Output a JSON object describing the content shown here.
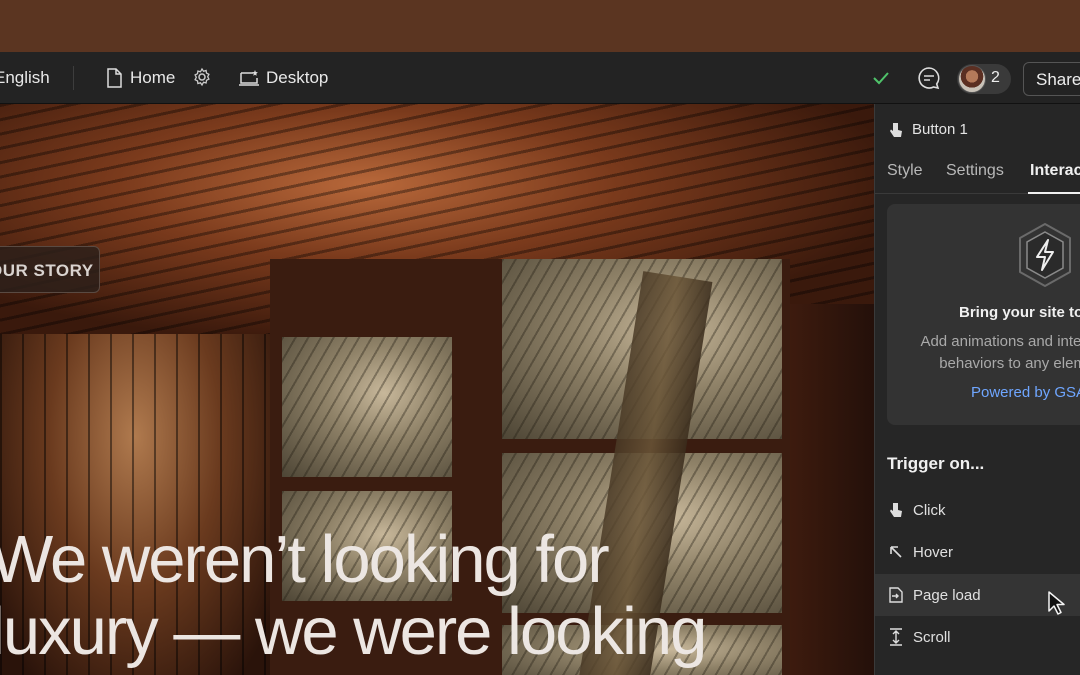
{
  "toolbar": {
    "language": "English",
    "page": "Home",
    "device": "Desktop",
    "collaborator_count": "2",
    "share_label": "Share"
  },
  "canvas": {
    "story_button": "OUR STORY",
    "headline_line1": "We weren’t looking for",
    "headline_line2": "luxury — we were looking"
  },
  "panel": {
    "element_name": "Button 1",
    "tabs": [
      "Style",
      "Settings",
      "Interactions"
    ],
    "promo": {
      "title": "Bring your site to life",
      "desc_line1": "Add animations and interactive",
      "desc_line2": "behaviors to any element",
      "link": "Powered by GSAP"
    },
    "trigger_heading": "Trigger on...",
    "triggers": [
      {
        "label": "Click",
        "icon": "hand-pointer-icon"
      },
      {
        "label": "Hover",
        "icon": "arrow-up-left-icon"
      },
      {
        "label": "Page load",
        "icon": "page-load-icon"
      },
      {
        "label": "Scroll",
        "icon": "scroll-icon"
      }
    ]
  },
  "colors": {
    "accent_link": "#6fa6ff",
    "status_check": "#4fc36a",
    "panel_bg": "#262626"
  }
}
